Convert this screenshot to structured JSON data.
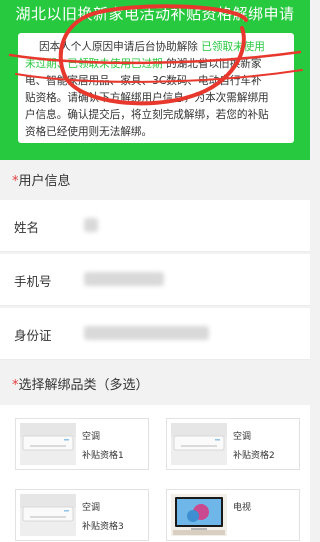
{
  "banner": {
    "title": "湖北以旧换新家电活动补贴资格解绑申请",
    "notice_lines": [
      [
        {
          "t": "因本人个人原因申请后台协助解除 ",
          "hl": false
        },
        {
          "t": "已领取未使用",
          "hl": true
        }
      ],
      [
        {
          "t": "未过期、已领取未使用已过期",
          "hl": true
        },
        {
          "t": " 的湖北省以旧换新家",
          "hl": false
        }
      ],
      [
        {
          "t": "电、智能家居用品、家具、3C数码、电动自行车补",
          "hl": false
        }
      ],
      [
        {
          "t": "贴资格。请确认下方解绑用户信息，为本次需解绑用",
          "hl": false
        }
      ],
      [
        {
          "t": "户信息。确认提交后，将立刻完成解绑，若您的补贴",
          "hl": false
        }
      ],
      [
        {
          "t": "资格已经使用则无法解绑。",
          "hl": false
        }
      ]
    ]
  },
  "user_info": {
    "header": "用户信息",
    "fields": [
      {
        "label": "姓名"
      },
      {
        "label": "手机号"
      },
      {
        "label": "身份证"
      }
    ]
  },
  "categories": {
    "header": "选择解绑品类（多选）",
    "items": [
      {
        "name": "空调",
        "sub": "补贴资格1",
        "icon": "air-conditioner-image"
      },
      {
        "name": "空调",
        "sub": "补贴资格2",
        "icon": "air-conditioner-image"
      },
      {
        "name": "空调",
        "sub": "补贴资格3",
        "icon": "air-conditioner-image"
      },
      {
        "name": "电视",
        "sub": "",
        "icon": "tv-image"
      }
    ]
  },
  "colors": {
    "accent": "#27c93f",
    "required": "#e23c3c",
    "annotation": "#e8382e"
  }
}
